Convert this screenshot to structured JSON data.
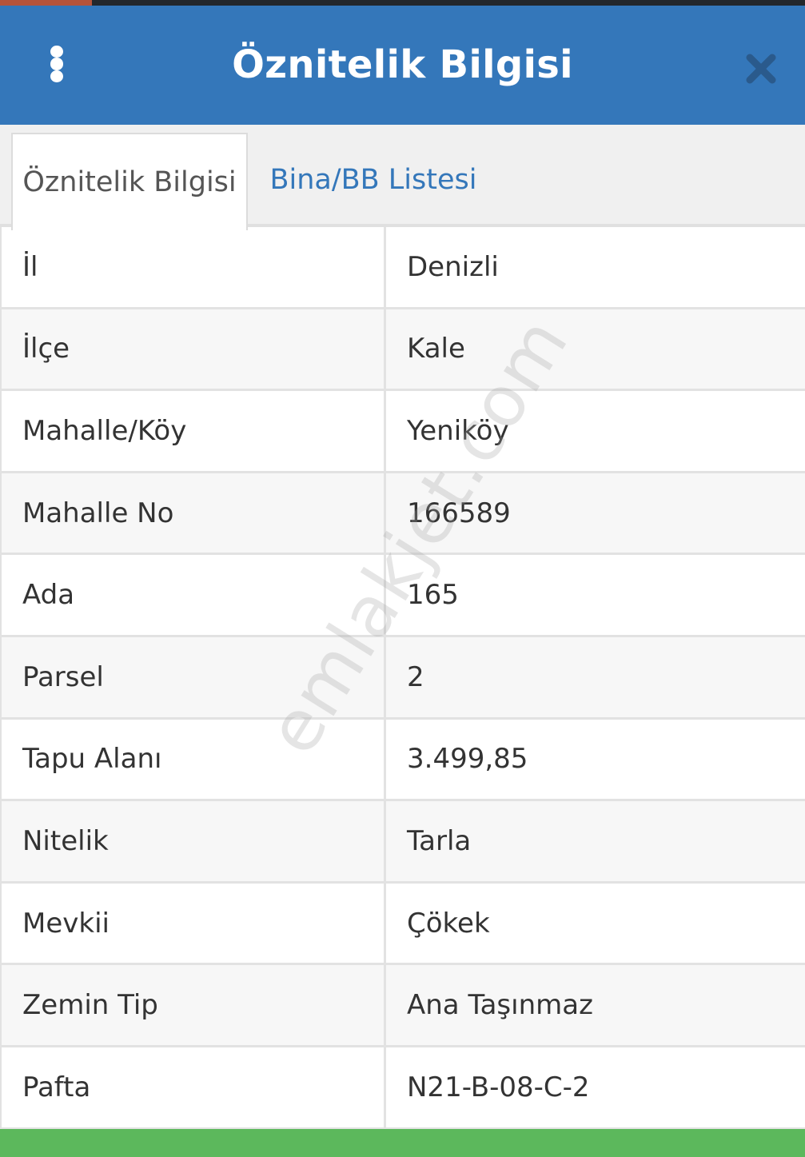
{
  "colors": {
    "header_bg": "#3477ba",
    "status_accent": "#b5533a",
    "close_icon": "#2a5a8c",
    "bottom_bar": "#5cb85c",
    "tab_inactive_text": "#3477ba"
  },
  "header": {
    "title": "Öznitelik Bilgisi",
    "menu_icon": "more-vertical-icon",
    "close_icon": "close-icon"
  },
  "tabs": [
    {
      "label": "Öznitelik Bilgisi",
      "active": true
    },
    {
      "label": "Bina/BB Listesi",
      "active": false
    }
  ],
  "rows": [
    {
      "label": "İl",
      "value": "Denizli"
    },
    {
      "label": "İlçe",
      "value": "Kale"
    },
    {
      "label": "Mahalle/Köy",
      "value": "Yeniköy"
    },
    {
      "label": "Mahalle No",
      "value": "166589"
    },
    {
      "label": "Ada",
      "value": "165"
    },
    {
      "label": "Parsel",
      "value": "2"
    },
    {
      "label": "Tapu Alanı",
      "value": "3.499,85"
    },
    {
      "label": "Nitelik",
      "value": "Tarla"
    },
    {
      "label": "Mevkii",
      "value": "Çökek"
    },
    {
      "label": "Zemin Tip",
      "value": "Ana Taşınmaz"
    },
    {
      "label": "Pafta",
      "value": "N21-B-08-C-2"
    }
  ],
  "watermark": "emlakjet.com"
}
